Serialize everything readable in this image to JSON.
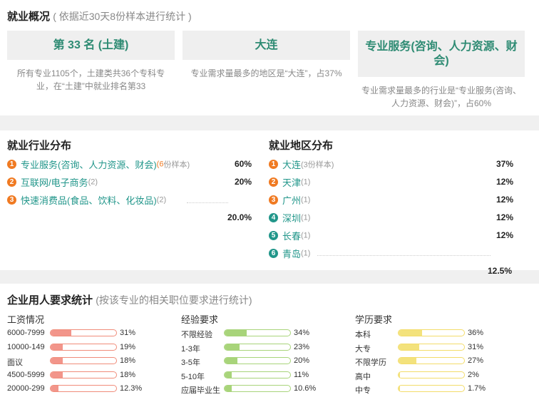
{
  "overview": {
    "title": "就业概况",
    "subtitle": "( 依据近30天8份样本进行统计 )",
    "cards": [
      {
        "value": "第 33 名 (土建)",
        "desc": "所有专业1105个，土建类共36个专科专业，在“土建”中就业排名第33"
      },
      {
        "value": "大连",
        "desc": "专业需求量最多的地区是“大连”，占37%"
      },
      {
        "value": "专业服务(咨询、人力资源、财会)",
        "desc": "专业需求量最多的行业是“专业服务(咨询、人力资源、财会)”，占60%"
      }
    ]
  },
  "industry": {
    "title": "就业行业分布",
    "items": [
      {
        "rank": "1",
        "label": "专业服务(咨询、人力资源、财会)",
        "count": "(6份样本)",
        "count_prefix": "(6",
        "count_suffix": "份样本)",
        "pct": "60%"
      },
      {
        "rank": "2",
        "label": "互联网/电子商务",
        "count": "(2)",
        "pct": "20%"
      },
      {
        "rank": "3",
        "label": "快速消费品(食品、饮料、化妆品)",
        "count": "(2)",
        "pct": ""
      }
    ],
    "extra_pct": "20.0%"
  },
  "region": {
    "title": "就业地区分布",
    "items": [
      {
        "rank": "1",
        "label": "大连",
        "count": "(3份样本)",
        "pct": "37%"
      },
      {
        "rank": "2",
        "label": "天津",
        "count": "(1)",
        "pct": "12%"
      },
      {
        "rank": "3",
        "label": "广州",
        "count": "(1)",
        "pct": "12%"
      },
      {
        "rank": "4",
        "label": "深圳",
        "count": "(1)",
        "pct": "12%"
      },
      {
        "rank": "5",
        "label": "长春",
        "count": "(1)",
        "pct": "12%"
      },
      {
        "rank": "6",
        "label": "青岛",
        "count": "(1)",
        "pct": ""
      }
    ],
    "extra_pct": "12.5%"
  },
  "requirements": {
    "title": "企业用人要求统计",
    "subtitle": "(按该专业的相关职位要求进行统计)",
    "salary": {
      "title": "工资情况",
      "rows": [
        {
          "label": "6000-7999",
          "pct": "31%",
          "fill": 0.31
        },
        {
          "label": "10000-149",
          "pct": "19%",
          "fill": 0.19
        },
        {
          "label": "面议",
          "pct": "18%",
          "fill": 0.18
        },
        {
          "label": "4500-5999",
          "pct": "18%",
          "fill": 0.18
        },
        {
          "label": "20000-299",
          "pct": "12.3%",
          "fill": 0.123
        }
      ]
    },
    "experience": {
      "title": "经验要求",
      "rows": [
        {
          "label": "不限经验",
          "pct": "34%",
          "fill": 0.34
        },
        {
          "label": "1-3年",
          "pct": "23%",
          "fill": 0.23
        },
        {
          "label": "3-5年",
          "pct": "20%",
          "fill": 0.2
        },
        {
          "label": "5-10年",
          "pct": "11%",
          "fill": 0.11
        },
        {
          "label": "应届毕业生",
          "pct": "10.6%",
          "fill": 0.106
        }
      ]
    },
    "education": {
      "title": "学历要求",
      "rows": [
        {
          "label": "本科",
          "pct": "36%",
          "fill": 0.36
        },
        {
          "label": "大专",
          "pct": "31%",
          "fill": 0.31
        },
        {
          "label": "不限学历",
          "pct": "27%",
          "fill": 0.27
        },
        {
          "label": "高中",
          "pct": "2%",
          "fill": 0.02
        },
        {
          "label": "中专",
          "pct": "1.7%",
          "fill": 0.017
        }
      ]
    }
  }
}
